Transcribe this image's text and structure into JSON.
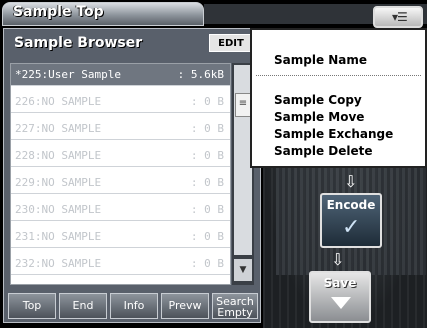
{
  "title": "Sample Top",
  "menu_icon": "menu-icon",
  "browser": {
    "title": "Sample Browser",
    "edit_label": "EDIT"
  },
  "samples": [
    {
      "name": "*225:User Sample",
      "size": ": 5.6kB"
    },
    {
      "name": "226:NO SAMPLE",
      "size": ":    0 B"
    },
    {
      "name": "227:NO SAMPLE",
      "size": ":    0 B"
    },
    {
      "name": "228:NO SAMPLE",
      "size": ":    0 B"
    },
    {
      "name": "229:NO SAMPLE",
      "size": ":    0 B"
    },
    {
      "name": "230:NO SAMPLE",
      "size": ":    0 B"
    },
    {
      "name": "231:NO SAMPLE",
      "size": ":    0 B"
    },
    {
      "name": "232:NO SAMPLE",
      "size": ":    0 B"
    }
  ],
  "buttons": {
    "top": "Top",
    "end": "End",
    "info": "Info",
    "preview": "Prevw",
    "search_line1": "Search",
    "search_line2": "Empty"
  },
  "workflow": {
    "encode_label": "Encode",
    "save_label": "Save"
  },
  "menu": {
    "sample_name": "Sample Name",
    "sample_copy": "Sample Copy",
    "sample_move": "Sample Move",
    "sample_exchange": "Sample Exchange",
    "sample_delete": "Sample Delete"
  }
}
